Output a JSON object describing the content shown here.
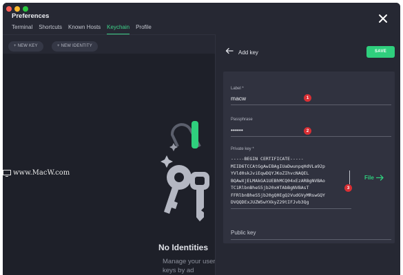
{
  "window": {
    "title": "Preferences",
    "traffic_colors": [
      "#fe5f57",
      "#febb2e",
      "#29c840"
    ]
  },
  "tabs": [
    {
      "label": "Terminal",
      "active": false
    },
    {
      "label": "Shortcuts",
      "active": false
    },
    {
      "label": "Known Hosts",
      "active": false
    },
    {
      "label": "Keychain",
      "active": true
    },
    {
      "label": "Profile",
      "active": false
    }
  ],
  "toolbar": {
    "new_key": "+ NEW KEY",
    "new_identity": "+ NEW IDENTITY"
  },
  "empty_state": {
    "title": "No Identities",
    "description": "Manage your user access keys by ad"
  },
  "watermark": {
    "text": "www.MacW.com"
  },
  "panel": {
    "title": "Add key",
    "save": "SAVE",
    "label_field": {
      "label": "Label *",
      "value": "macw",
      "badge": "1"
    },
    "passphrase_field": {
      "label": "Passphrase",
      "value": "••••••",
      "badge": "2"
    },
    "private_key_field": {
      "label": "Private key *",
      "lines": [
        "-----BEGIN CERTIFICATE-----",
        "MIID6TCCAtGgAwIBAgIUaDwunpqHdVLa92p",
        "YVld0skJviEqwDQYJKoZIhvcNAQEL",
        "BQAwXjELMAkGA1UEBhMCQ04xEzARBgNVBAo",
        "TC1RlbnBheS5jb20xHTAbBgNVBAsT",
        "FFRlbnBheS5jb20gQ0EgQ2VudGVyMRswGQY",
        "DVQQDExJUZW5wYXkyZ29tIFJvb3Qg"
      ],
      "badge": "3",
      "file_button": "File"
    },
    "public_key_field": {
      "label": "Public key"
    }
  },
  "colors": {
    "accent": "#3ed38a",
    "save": "#2fcf7d",
    "badge": "#d92f34"
  }
}
